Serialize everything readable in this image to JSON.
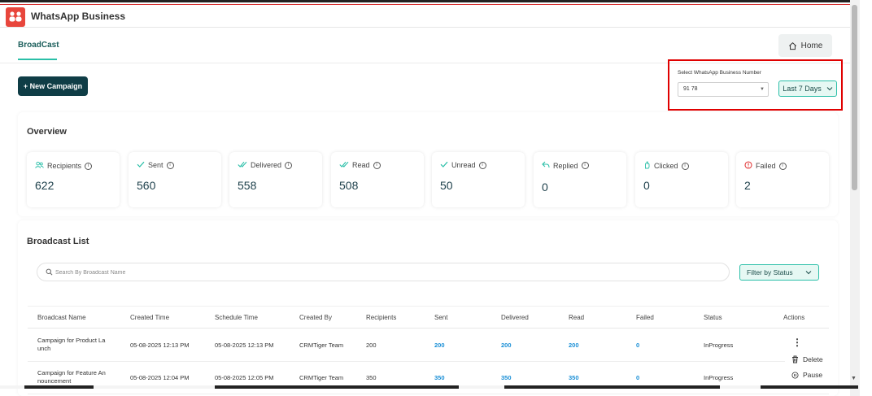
{
  "app": {
    "title": "WhatsApp Business"
  },
  "tabs": {
    "broadcast": "BroadCast"
  },
  "header": {
    "home_label": "Home"
  },
  "toolbar": {
    "new_campaign_label": "+ New Campaign"
  },
  "number_selector": {
    "label": "Select WhatsApp Business Number",
    "value": "91          78"
  },
  "date_filter": {
    "label": "Last 7 Days"
  },
  "overview": {
    "title": "Overview",
    "stats": [
      {
        "label": "Recipients",
        "value": "622",
        "icon": "users-icon",
        "color": "#2bbfa8"
      },
      {
        "label": "Sent",
        "value": "560",
        "icon": "check-icon",
        "color": "#2bbfa8"
      },
      {
        "label": "Delivered",
        "value": "558",
        "icon": "double-check-icon",
        "color": "#2bbfa8"
      },
      {
        "label": "Read",
        "value": "508",
        "icon": "double-check-icon",
        "color": "#2bbfa8"
      },
      {
        "label": "Unread",
        "value": "50",
        "icon": "check-icon",
        "color": "#2bbfa8"
      },
      {
        "label": "Replied",
        "value": "0",
        "icon": "reply-icon",
        "color": "#2bbfa8"
      },
      {
        "label": "Clicked",
        "value": "0",
        "icon": "click-icon",
        "color": "#2bbfa8"
      },
      {
        "label": "Failed",
        "value": "2",
        "icon": "alert-icon",
        "color": "#e23b3b"
      }
    ]
  },
  "broadcast_list": {
    "title": "Broadcast List",
    "search_placeholder": "Search By Broadcast Name",
    "filter_label": "Filter by Status",
    "columns": [
      "Broadcast Name",
      "Created Time",
      "Schedule Time",
      "Created By",
      "Recipients",
      "Sent",
      "Delivered",
      "Read",
      "Failed",
      "Status",
      "Actions"
    ],
    "rows": [
      {
        "name": "Campaign for Product La unch",
        "created": "05-08-2025 12:13 PM",
        "scheduled": "05-08-2025 12:13 PM",
        "by": "CRMTiger Team",
        "recipients": "200",
        "sent": "200",
        "delivered": "200",
        "read": "200",
        "failed": "0",
        "status": "InProgress"
      },
      {
        "name": "Campaign for Feature An nouncement",
        "created": "05-08-2025 12:04 PM",
        "scheduled": "05-08-2025 12:05 PM",
        "by": "CRMTiger Team",
        "recipients": "350",
        "sent": "350",
        "delivered": "350",
        "read": "350",
        "failed": "0",
        "status": "InProgress"
      }
    ],
    "actions_menu": {
      "delete": "Delete",
      "pause": "Pause"
    }
  }
}
